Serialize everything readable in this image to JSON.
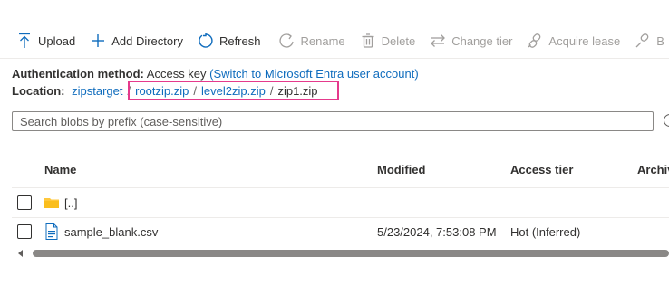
{
  "toolbar": {
    "upload": "Upload",
    "add_directory": "Add Directory",
    "refresh": "Refresh",
    "rename": "Rename",
    "delete": "Delete",
    "change_tier": "Change tier",
    "acquire_lease": "Acquire lease",
    "break_lease_partial": "B"
  },
  "auth": {
    "label": "Authentication method:",
    "value": "Access key",
    "link": "(Switch to Microsoft Entra user account)"
  },
  "location": {
    "label": "Location:",
    "crumbs": [
      "zipstarget",
      "rootzip.zip",
      "level2zip.zip",
      "zip1.zip"
    ],
    "separator": "/"
  },
  "search": {
    "placeholder": "Search blobs by prefix (case-sensitive)",
    "value": ""
  },
  "table": {
    "columns": [
      "Name",
      "Modified",
      "Access tier",
      "Archive"
    ],
    "rows": [
      {
        "type": "folder",
        "name": "[..]",
        "modified": "",
        "access_tier": ""
      },
      {
        "type": "file",
        "name": "sample_blank.csv",
        "modified": "5/23/2024, 7:53:08 PM",
        "access_tier": "Hot (Inferred)"
      }
    ]
  },
  "colors": {
    "accent": "#0f6cbd",
    "highlight": "#e53a8c",
    "folder": "#ffc83d",
    "disabled": "#a19f9d"
  }
}
